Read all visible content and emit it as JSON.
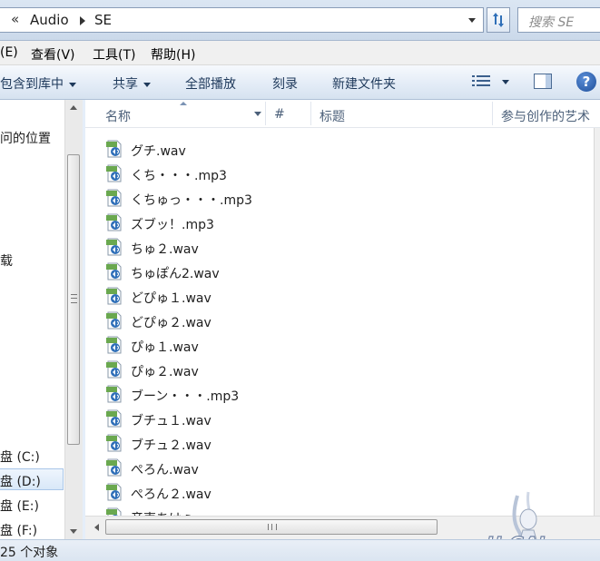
{
  "address": {
    "overflow_chevron": "«",
    "segments": [
      "Audio",
      "SE"
    ],
    "search_placeholder": "搜索 SE"
  },
  "menu": {
    "items": [
      "(E)",
      "查看(V)",
      "工具(T)",
      "帮助(H)"
    ]
  },
  "toolbar": {
    "include_library": "包含到库中",
    "share": "共享",
    "play_all": "全部播放",
    "burn": "刻录",
    "new_folder": "新建文件夹",
    "help": "?"
  },
  "nav": {
    "items": [
      "问的位置",
      "载",
      "盘 (C:)",
      "盘 (D:)",
      "盘 (E:)",
      "盘 (F:)"
    ],
    "selected_item": "盘 (D:)"
  },
  "columns": {
    "name": "名称",
    "number": "#",
    "title": "标题",
    "artists": "参与创作的艺术"
  },
  "files": [
    {
      "name": "グチ.wav",
      "type": "wav"
    },
    {
      "name": "くち・・・.mp3",
      "type": "mp3"
    },
    {
      "name": "くちゅっ・・・.mp3",
      "type": "mp3"
    },
    {
      "name": "ズブッ！.mp3",
      "type": "mp3"
    },
    {
      "name": "ちゅ２.wav",
      "type": "wav"
    },
    {
      "name": "ちゅぽん2.wav",
      "type": "wav"
    },
    {
      "name": "どぴゅ１.wav",
      "type": "wav"
    },
    {
      "name": "どぴゅ２.wav",
      "type": "wav"
    },
    {
      "name": "ぴゅ１.wav",
      "type": "wav"
    },
    {
      "name": "ぴゅ２.wav",
      "type": "wav"
    },
    {
      "name": "ブーン・・・.mp3",
      "type": "mp3"
    },
    {
      "name": "ブチュ１.wav",
      "type": "wav"
    },
    {
      "name": "ブチュ２.wav",
      "type": "wav"
    },
    {
      "name": "ぺろん.wav",
      "type": "wav"
    },
    {
      "name": "ぺろん２.wav",
      "type": "wav"
    },
    {
      "name": "音声あけぇ.wav",
      "type": "wav"
    }
  ],
  "status": {
    "object_count": "25 个对象"
  },
  "watermark": {
    "text": "H-GAL"
  },
  "colors": {
    "toolbar_text": "#1e395b",
    "column_header_text": "#4c607a",
    "selection_bg": "#d9e8f8"
  }
}
